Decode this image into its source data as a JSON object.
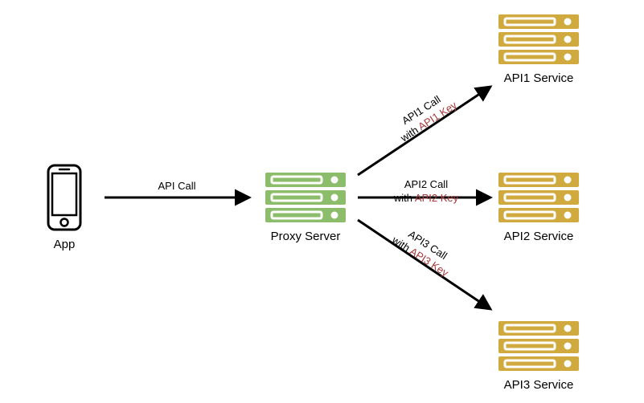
{
  "nodes": {
    "app": {
      "label": "App"
    },
    "proxy": {
      "label": "Proxy Server"
    },
    "api1": {
      "label": "API1 Service"
    },
    "api2": {
      "label": "API2 Service"
    },
    "api3": {
      "label": "API3 Service"
    }
  },
  "edges": {
    "app_to_proxy": {
      "label": "API Call"
    },
    "proxy_to_api1": {
      "line1": "API1 Call",
      "line2_prefix": "with ",
      "line2_key": "API1 Key"
    },
    "proxy_to_api2": {
      "line1": "API2 Call",
      "line2_prefix": "with ",
      "line2_key": "API2 Key"
    },
    "proxy_to_api3": {
      "line1": "API3 Call",
      "line2_prefix": "with ",
      "line2_key": "API3 Key"
    }
  },
  "colors": {
    "proxy_fill": "#8bbd6a",
    "api_fill": "#d0a93f",
    "phone_stroke": "#000000",
    "arrow": "#000000"
  }
}
